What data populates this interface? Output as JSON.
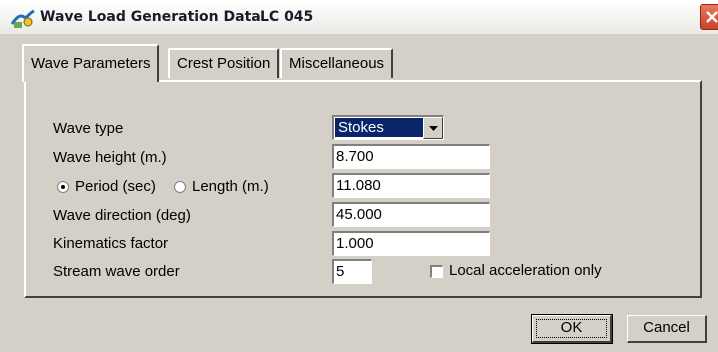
{
  "window": {
    "title": "Wave Load Generation Data",
    "load_case": "LC 045",
    "icon": "app-icon"
  },
  "tabs": [
    {
      "label": "Wave Parameters",
      "active": true
    },
    {
      "label": "Crest Position",
      "active": false
    },
    {
      "label": "Miscellaneous",
      "active": false
    }
  ],
  "form": {
    "wave_type": {
      "label": "Wave type",
      "value": "Stokes"
    },
    "wave_height": {
      "label": "Wave height (m.)",
      "value": "8.700"
    },
    "period_length": {
      "period_label": "Period (sec)",
      "length_label": "Length  (m.)",
      "selected": "period",
      "value": "11.080"
    },
    "wave_direction": {
      "label": "Wave direction (deg)",
      "value": "45.000"
    },
    "kinematics_factor": {
      "label": "Kinematics factor",
      "value": "1.000"
    },
    "stream_wave_order": {
      "label": "Stream wave order",
      "value": "5"
    },
    "local_acceleration": {
      "label": "Local acceleration only",
      "checked": false
    }
  },
  "buttons": {
    "ok": "OK",
    "cancel": "Cancel"
  },
  "colors": {
    "dialog_bg": "#d4d0c8",
    "selection": "#0a246a",
    "close_button": "#d9573c"
  }
}
